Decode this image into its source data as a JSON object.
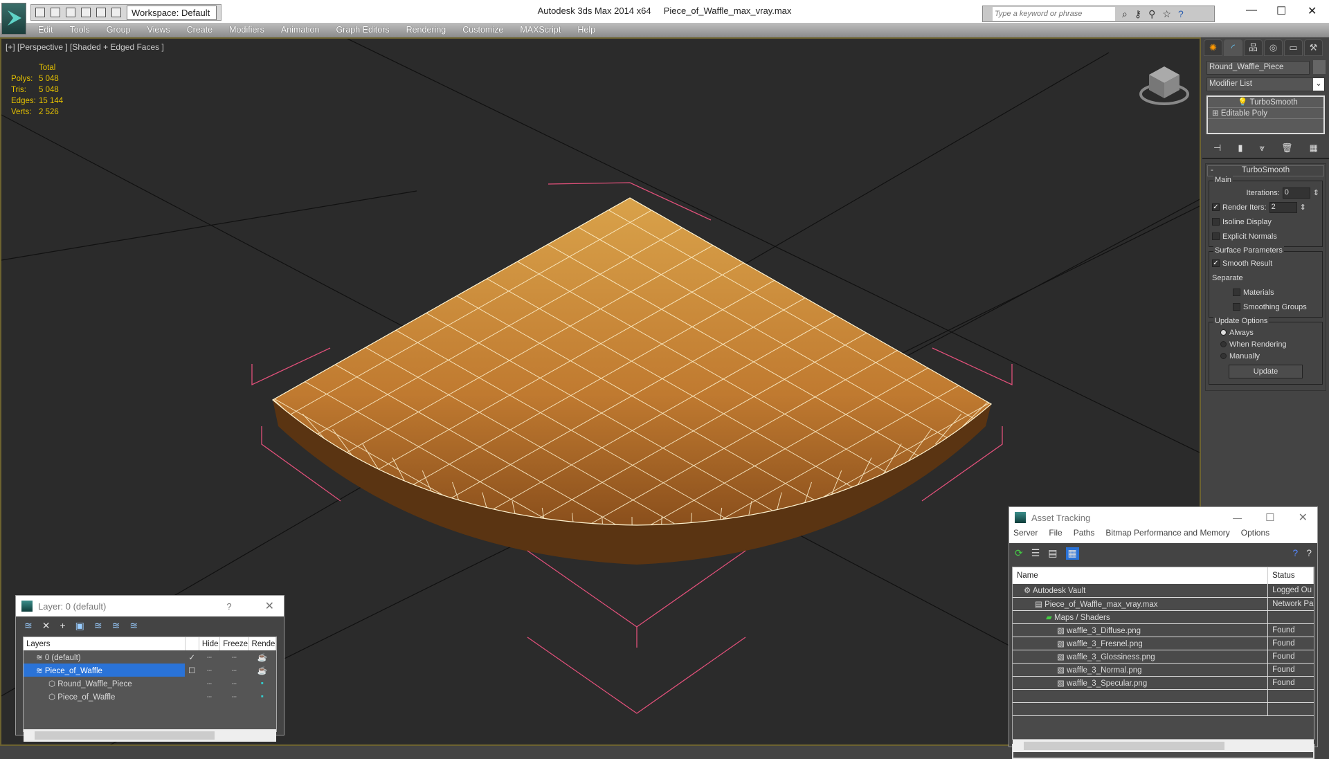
{
  "app": {
    "title": "Autodesk 3ds Max  2014 x64",
    "file": "Piece_of_Waffle_max_vray.max",
    "workspace": "Workspace: Default",
    "search_placeholder": "Type a keyword or phrase"
  },
  "menu": [
    "Edit",
    "Tools",
    "Group",
    "Views",
    "Create",
    "Modifiers",
    "Animation",
    "Graph Editors",
    "Rendering",
    "Customize",
    "MAXScript",
    "Help"
  ],
  "viewport": {
    "label": "[+] [Perspective ] [Shaded + Edged Faces ]",
    "stats_header": "Total",
    "stats": [
      {
        "k": "Polys:",
        "v": "5 048"
      },
      {
        "k": "Tris:",
        "v": "5 048"
      },
      {
        "k": "Edges:",
        "v": "15 144"
      },
      {
        "k": "Verts:",
        "v": "2 526"
      }
    ]
  },
  "command_panel": {
    "object_name": "Round_Waffle_Piece",
    "modifier_list": "Modifier List",
    "stack": [
      "TurboSmooth",
      "Editable Poly"
    ],
    "rollout": "TurboSmooth",
    "main": "Main",
    "iterations_label": "Iterations:",
    "iterations": "0",
    "render_iters_label": "Render Iters:",
    "render_iters": "2",
    "isoline": "Isoline Display",
    "explicit": "Explicit Normals",
    "surface": "Surface Parameters",
    "smooth_result": "Smooth Result",
    "separate": "Separate",
    "materials": "Materials",
    "smoothing_groups": "Smoothing Groups",
    "update_options": "Update Options",
    "always": "Always",
    "when_rendering": "When Rendering",
    "manually": "Manually",
    "update": "Update"
  },
  "layer_dialog": {
    "title": "Layer: 0 (default)",
    "help": "?",
    "columns": [
      "Layers",
      "",
      "Hide",
      "Freeze",
      "Rende"
    ],
    "rows": [
      {
        "name": "0 (default)",
        "indent": 1,
        "check": "✓"
      },
      {
        "name": "Piece_of_Waffle",
        "indent": 1,
        "check": "☐",
        "selected": true
      },
      {
        "name": "Round_Waffle_Piece",
        "indent": 2
      },
      {
        "name": "Piece_of_Waffle",
        "indent": 2
      }
    ]
  },
  "asset_dialog": {
    "title": "Asset Tracking",
    "menu": [
      "Server",
      "File",
      "Paths",
      "Bitmap Performance and Memory",
      "Options"
    ],
    "columns": [
      "Name",
      "Status"
    ],
    "rows": [
      {
        "name": "Autodesk Vault",
        "status": "Logged Ou",
        "indent": 1
      },
      {
        "name": "Piece_of_Waffle_max_vray.max",
        "status": "Network Pa",
        "indent": 2
      },
      {
        "name": "Maps / Shaders",
        "status": "",
        "indent": 3
      },
      {
        "name": "waffle_3_Diffuse.png",
        "status": "Found",
        "indent": 4
      },
      {
        "name": "waffle_3_Fresnel.png",
        "status": "Found",
        "indent": 4
      },
      {
        "name": "waffle_3_Glossiness.png",
        "status": "Found",
        "indent": 4
      },
      {
        "name": "waffle_3_Normal.png",
        "status": "Found",
        "indent": 4
      },
      {
        "name": "waffle_3_Specular.png",
        "status": "Found",
        "indent": 4
      }
    ]
  },
  "colors": {
    "stats": "#e5c100",
    "viewport": "#2b2b2b",
    "selection": "#2a73d8",
    "bbox": "#e0507a",
    "waffle": "#c8873a"
  }
}
